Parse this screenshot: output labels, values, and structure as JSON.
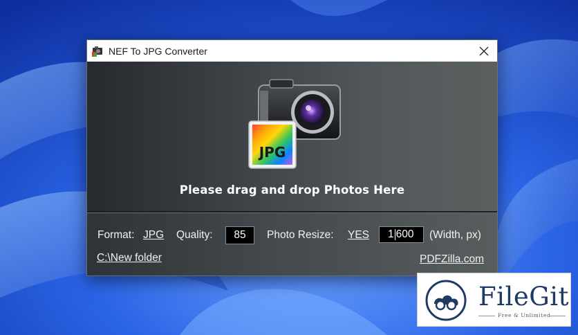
{
  "window": {
    "title": "NEF To JPG Converter",
    "close_glyph": "✕",
    "icon": "app-icon"
  },
  "drop_area": {
    "art_label": "JPG",
    "instruction": "Please drag and drop Photos Here"
  },
  "settings": {
    "format_label": "Format:",
    "format_value": "JPG",
    "quality_label": "Quality:",
    "quality_value": "85",
    "resize_label": "Photo Resize:",
    "resize_value": "YES",
    "resize_width_before_caret": "1",
    "resize_width_after_caret": "600",
    "resize_unit": "(Width, px)",
    "output_folder": "C:\\New folder",
    "website_link": "PDFZilla.com"
  },
  "watermark": {
    "name": "FileGit",
    "tagline": "Free & Unlimited"
  },
  "colors": {
    "wallpaper": "#1a4fd0",
    "window_dark": "#262a2e",
    "badge_text": "#1f3a63"
  }
}
